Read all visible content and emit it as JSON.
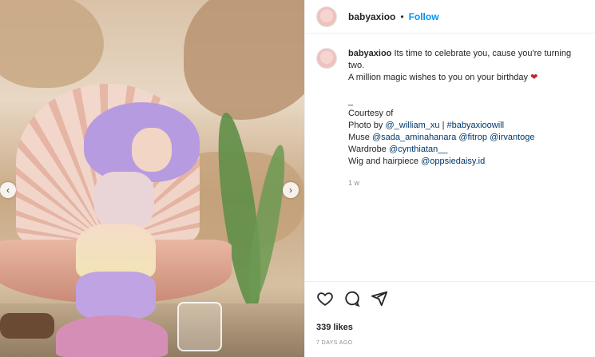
{
  "post": {
    "username": "babyaxioo",
    "follow_label": "Follow",
    "header_separator": "•",
    "caption": {
      "username": "babyaxioo",
      "line1": "Its time to celebrate you, cause you're turning two.",
      "line2": "A million magic wishes to you on your birthday",
      "heart_glyph": "❤",
      "underscore": "_",
      "courtesy": "Courtesy of",
      "photo_by_label": "Photo by",
      "photo_by_1": "@_william_xu",
      "photo_sep": "|",
      "photo_by_2": "#babyaxioowill",
      "muse_label": "Muse",
      "muse_1": "@sada_aminahanara",
      "muse_2": "@fitrop",
      "muse_3": "@irvantoge",
      "wardrobe_label": "Wardrobe",
      "wardrobe_1": "@cynthiatan__",
      "wig_label": "Wig and hairpiece",
      "wig_1": "@oppsiedaisy.id",
      "time": "1 w"
    },
    "likes": "339 likes",
    "posted_ago": "7 DAYS AGO",
    "nav": {
      "prev": "‹",
      "next": "›"
    }
  },
  "colors": {
    "follow": "#0095f6",
    "link": "#00376b",
    "heart": "#c0262d",
    "muted": "#8e8e8e"
  },
  "icons": [
    "heart-icon",
    "comment-icon",
    "share-icon",
    "chevron-left-icon",
    "chevron-right-icon"
  ]
}
